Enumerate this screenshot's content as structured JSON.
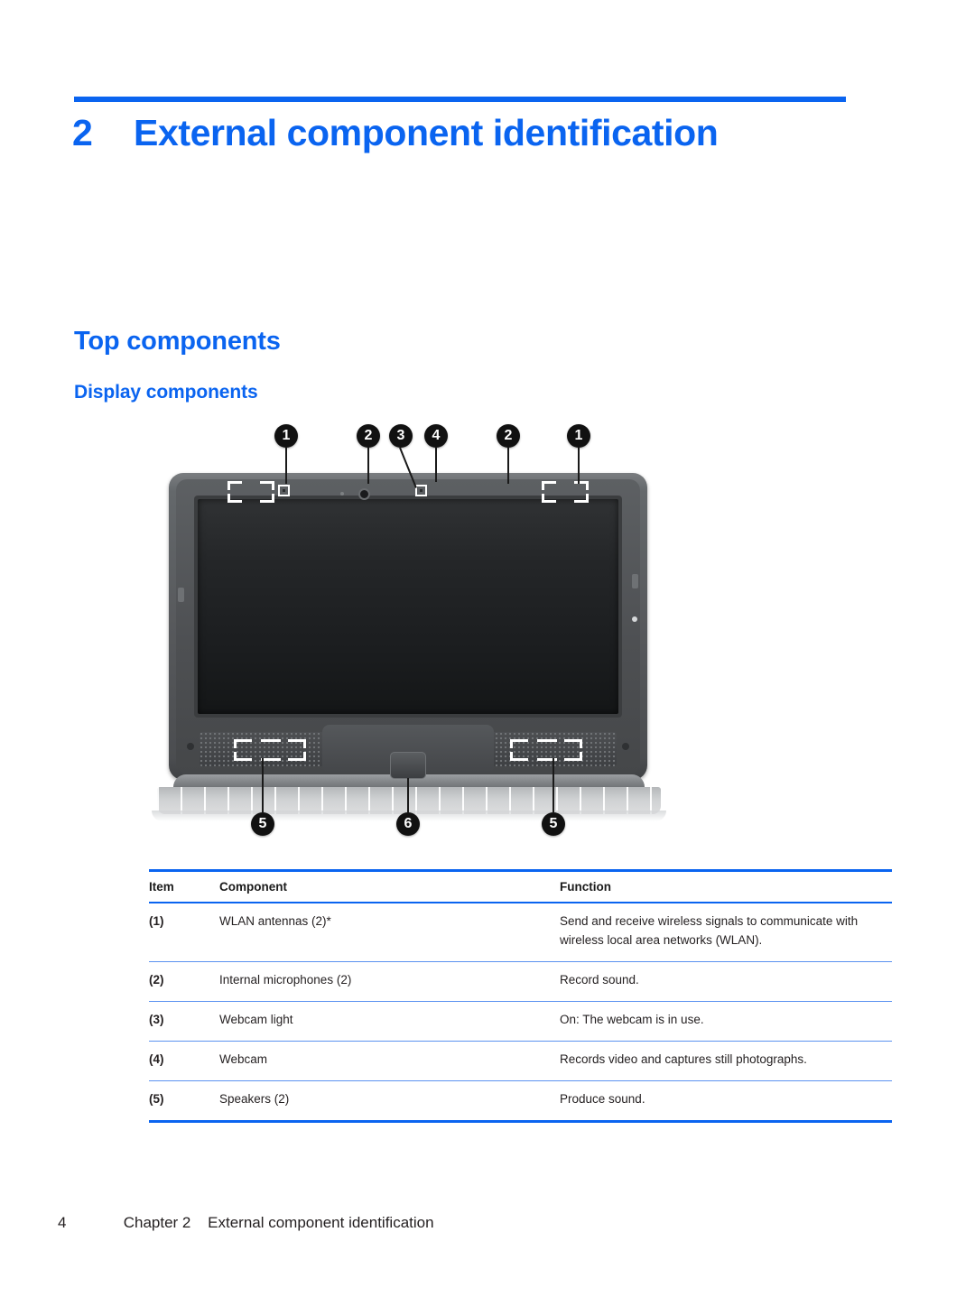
{
  "chapter": {
    "number": "2",
    "title": "External component identification"
  },
  "headings": {
    "section": "Top components",
    "subsection": "Display components"
  },
  "figure": {
    "alt_label": "Display components diagram",
    "callouts": [
      {
        "id": "c1-left",
        "label": "1",
        "target": "wlan-antenna-left"
      },
      {
        "id": "c2-left",
        "label": "2",
        "target": "internal-microphone-left"
      },
      {
        "id": "c3",
        "label": "3",
        "target": "webcam-light"
      },
      {
        "id": "c4",
        "label": "4",
        "target": "webcam"
      },
      {
        "id": "c2-right",
        "label": "2",
        "target": "internal-microphone-right"
      },
      {
        "id": "c1-right",
        "label": "1",
        "target": "wlan-antenna-right"
      },
      {
        "id": "c5-left",
        "label": "5",
        "target": "speaker-left"
      },
      {
        "id": "c6",
        "label": "6",
        "target": "display-release-latch"
      },
      {
        "id": "c5-right",
        "label": "5",
        "target": "speaker-right"
      }
    ]
  },
  "table": {
    "columns": [
      "Item",
      "Component",
      "Function"
    ],
    "rows": [
      {
        "item": "(1)",
        "component": "WLAN antennas (2)*",
        "function": "Send and receive wireless signals to communicate with wireless local area networks (WLAN)."
      },
      {
        "item": "(2)",
        "component": "Internal microphones (2)",
        "function": "Record sound."
      },
      {
        "item": "(3)",
        "component": "Webcam light",
        "function": "On: The webcam is in use."
      },
      {
        "item": "(4)",
        "component": "Webcam",
        "function": "Records video and captures still photographs."
      },
      {
        "item": "(5)",
        "component": "Speakers (2)",
        "function": "Produce sound."
      }
    ]
  },
  "footer": {
    "page_number": "4",
    "chapter_label": "Chapter 2",
    "chapter_title": "External component identification"
  },
  "colors": {
    "accent_blue": "#0a64f0",
    "rule_light_blue": "#5b92f0",
    "body_text": "#231f20"
  }
}
